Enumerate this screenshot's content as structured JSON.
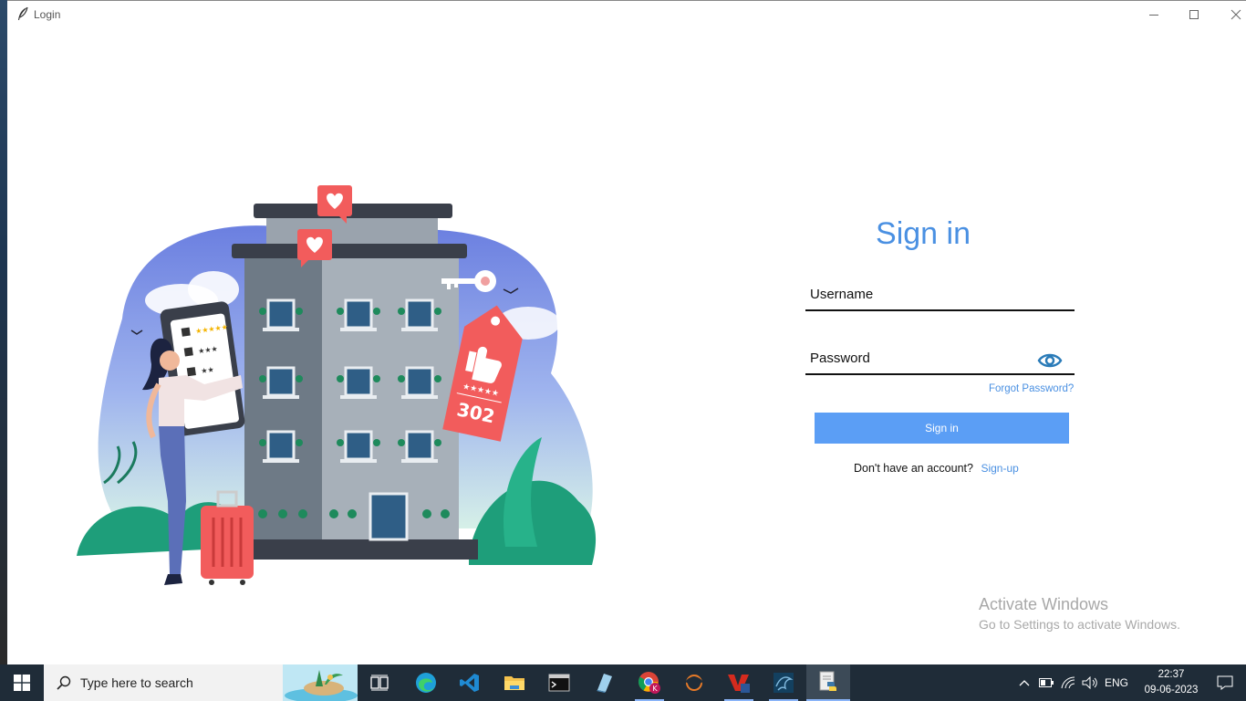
{
  "window": {
    "title": "Login"
  },
  "form": {
    "heading": "Sign in",
    "username_placeholder": "Username",
    "password_placeholder": "Password",
    "forgot_label": "Forgot Password?",
    "signin_label": "Sign in",
    "no_account_text": "Don't have an account?",
    "signup_label": "Sign-up",
    "accent_color": "#4a90e2",
    "button_color": "#5b9ef5"
  },
  "illustration": {
    "tag_number": "302",
    "checklist_stars": [
      "★★★★★",
      "★★★",
      "★★"
    ]
  },
  "watermark": {
    "line1": "Activate Windows",
    "line2": "Go to Settings to activate Windows."
  },
  "taskbar": {
    "search_placeholder": "Type here to search",
    "apps": [
      "task-view",
      "edge",
      "vscode",
      "file-explorer",
      "terminal",
      "notepad",
      "chrome",
      "matlab",
      "wps",
      "mysql-workbench",
      "python-idle"
    ],
    "language": "ENG",
    "time": "22:37",
    "date": "09-06-2023"
  }
}
